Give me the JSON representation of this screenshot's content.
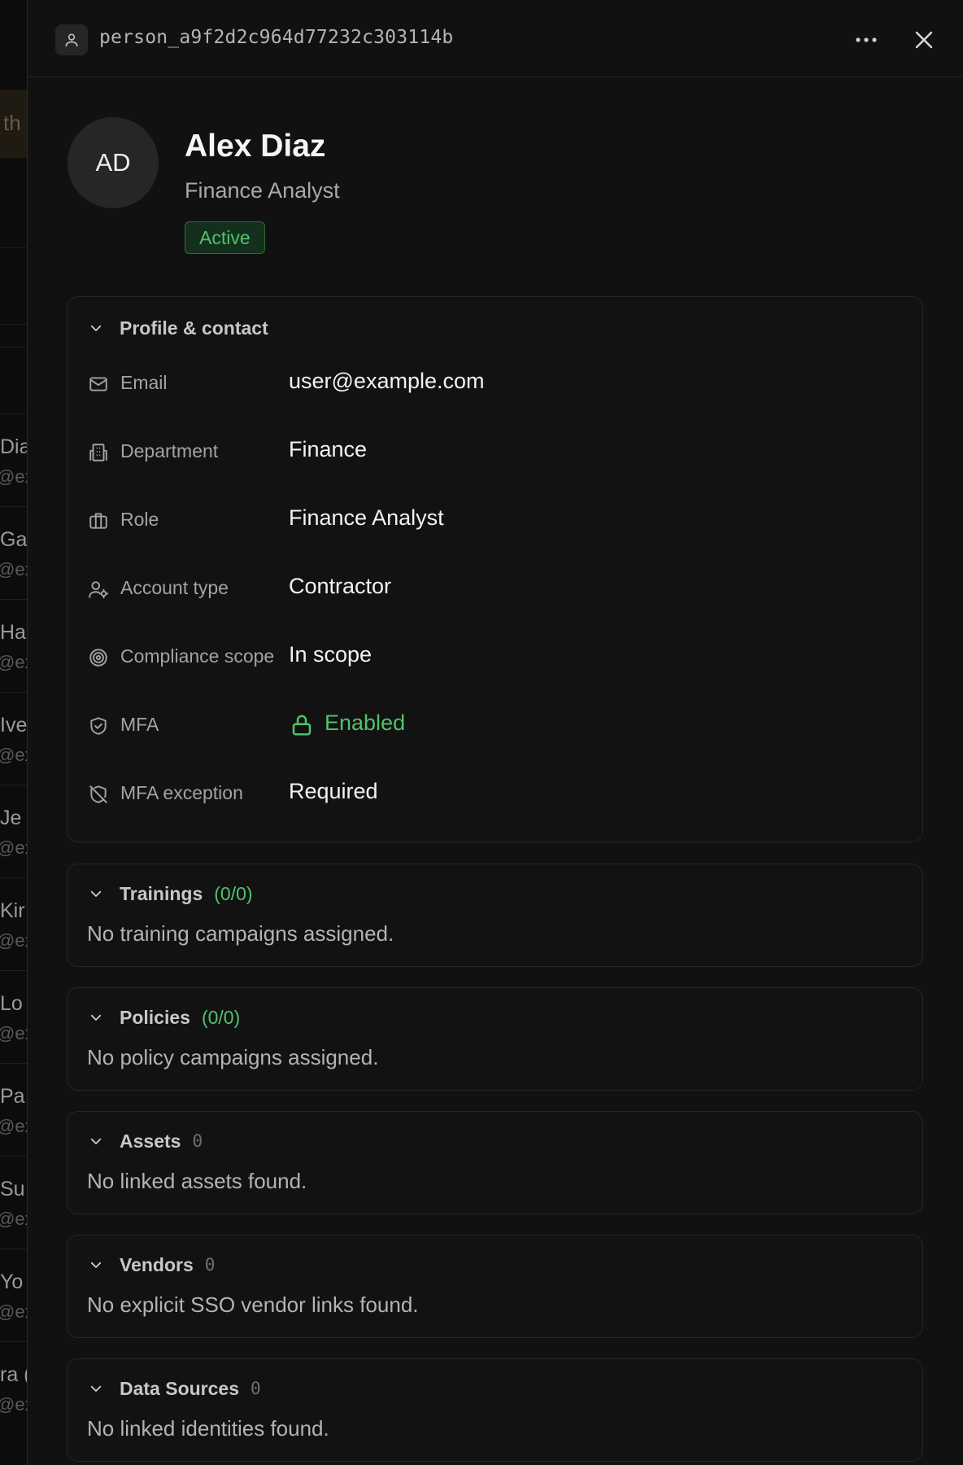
{
  "background_list": {
    "highlight_text": "th",
    "rows": [
      {
        "name": "Dia",
        "email": "@ex"
      },
      {
        "name": "Ga",
        "email": "@ex"
      },
      {
        "name": "Ha",
        "email": "@ex"
      },
      {
        "name": "Ive",
        "email": "@ex"
      },
      {
        "name": "Je",
        "email": "@ex"
      },
      {
        "name": "Kir",
        "email": "@ex"
      },
      {
        "name": "Lo",
        "email": "@ex"
      },
      {
        "name": "Pa",
        "email": "@ex"
      },
      {
        "name": "Su",
        "email": "@ex"
      },
      {
        "name": "Yo",
        "email": "@ex"
      },
      {
        "name": "ra (",
        "email": "@ex"
      }
    ]
  },
  "header": {
    "person_id": "person_a9f2d2c964d77232c303114b",
    "icons": {
      "person": "person-icon",
      "more": "more-horizontal-icon",
      "close": "close-icon"
    }
  },
  "profile": {
    "initials": "AD",
    "name": "Alex Diaz",
    "title": "Finance Analyst",
    "status": "Active",
    "status_color": "#4fc36b"
  },
  "profile_contact": {
    "label": "Profile & contact",
    "fields": {
      "email": {
        "label": "Email",
        "value": "user@example.com",
        "icon": "mail-icon"
      },
      "department": {
        "label": "Department",
        "value": "Finance",
        "icon": "building-icon"
      },
      "role": {
        "label": "Role",
        "value": "Finance Analyst",
        "icon": "briefcase-icon"
      },
      "account_type": {
        "label": "Account type",
        "value": "Contractor",
        "icon": "user-gear-icon"
      },
      "compliance_scope": {
        "label": "Compliance scope",
        "value": "In scope",
        "icon": "target-icon"
      },
      "mfa": {
        "label": "MFA",
        "value": "Enabled",
        "icon": "shield-check-icon",
        "value_icon": "lock-icon"
      },
      "mfa_exception": {
        "label": "MFA exception",
        "value": "Required",
        "icon": "shield-off-icon"
      }
    }
  },
  "trainings": {
    "label": "Trainings",
    "count": "(0/0)",
    "empty": "No training campaigns assigned."
  },
  "policies": {
    "label": "Policies",
    "count": "(0/0)",
    "empty": "No policy campaigns assigned."
  },
  "assets": {
    "label": "Assets",
    "count": "0",
    "empty": "No linked assets found."
  },
  "vendors": {
    "label": "Vendors",
    "count": "0",
    "empty": "No explicit SSO vendor links found."
  },
  "data_sources": {
    "label": "Data Sources",
    "count": "0",
    "empty": "No linked identities found."
  },
  "colors": {
    "accent_green": "#4fc36b",
    "background": "#111111",
    "card_border": "#262626"
  }
}
